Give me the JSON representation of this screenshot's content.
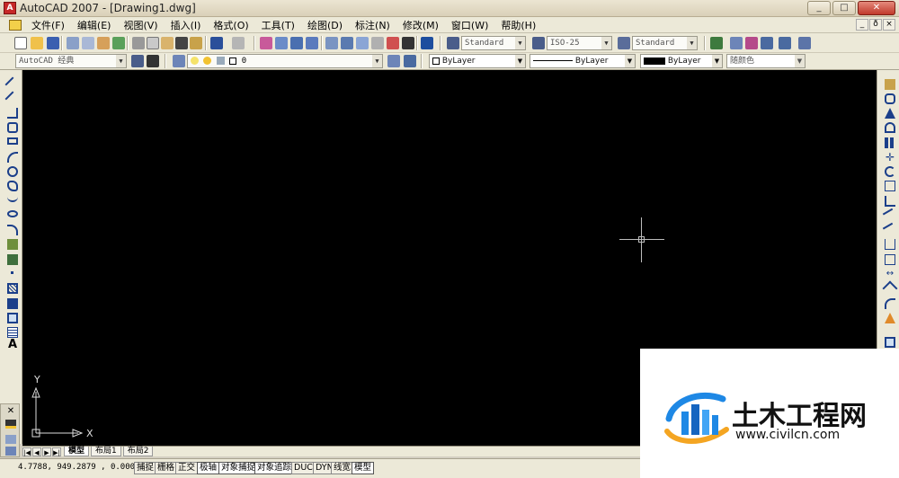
{
  "window": {
    "title": "AutoCAD 2007 - [Drawing1.dwg]",
    "minimize": "_",
    "maximize": "□",
    "close": "✕"
  },
  "menu": {
    "items": [
      "文件(F)",
      "编辑(E)",
      "视图(V)",
      "插入(I)",
      "格式(O)",
      "工具(T)",
      "绘图(D)",
      "标注(N)",
      "修改(M)",
      "窗口(W)",
      "帮助(H)"
    ],
    "mdi": [
      "_",
      "ð",
      "×"
    ]
  },
  "toolbar": {
    "text_style": "Standard",
    "dim_style": "ISO-25",
    "table_style": "Standard",
    "workspace": "AutoCAD 经典",
    "layer": "0",
    "color": "ByLayer",
    "linetype": "ByLayer",
    "lineweight": "ByLayer",
    "plot_style": "随颜色"
  },
  "canvas": {
    "background": "#000000",
    "ucs_x": "X",
    "ucs_y": "Y"
  },
  "tabs": {
    "nav": [
      "|◀",
      "◀",
      "▶",
      "▶|"
    ],
    "items": [
      "模型",
      "布局1",
      "布局2"
    ]
  },
  "status": {
    "coords": "4.7788, 949.2879 , 0.0000",
    "buttons": [
      "捕捉",
      "栅格",
      "正交",
      "极轴",
      "对象捕捉",
      "对象追踪",
      "DUCS",
      "DYN",
      "线宽",
      "模型"
    ]
  },
  "watermark": {
    "title": "土木工程网",
    "url": "www.civilcn.com"
  },
  "colors": {
    "accent": "#1e88e5",
    "logo_orange": "#f4a522"
  }
}
